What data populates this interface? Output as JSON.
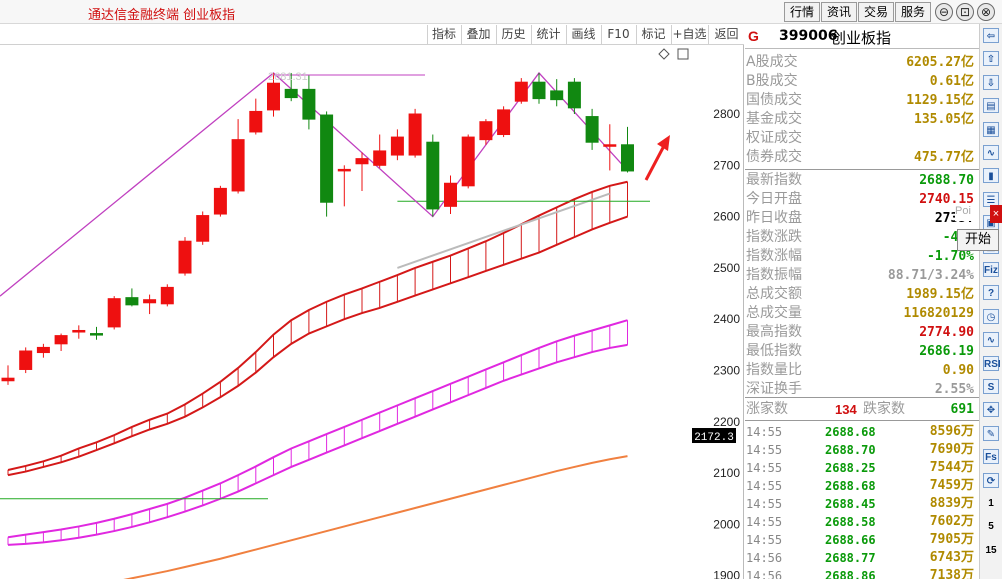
{
  "app_title": "通达信金融终端 创业板指",
  "menu": [
    "行情",
    "资讯",
    "交易",
    "服务"
  ],
  "window_controls": [
    "⊖",
    "⊡",
    "⊗"
  ],
  "toolbar": [
    "指标",
    "叠加",
    "历史",
    "统计",
    "画线",
    "F10",
    "标记",
    "+自选",
    "返回"
  ],
  "chart": {
    "overlay_label": "2681.31",
    "price_marker": "2172.3",
    "axis_labels": [
      "2800",
      "2700",
      "2600",
      "2500",
      "2400",
      "2300",
      "2200",
      "2100",
      "2000",
      "1900"
    ],
    "colors": {
      "up": "#ee1010",
      "down": "#118811",
      "zigzag": "#c040c0",
      "band_red": "#d41818",
      "band_magenta": "#e028e0",
      "orange": "#f08040"
    }
  },
  "chart_data": {
    "type": "candlestick",
    "title": "",
    "ylim": [
      1900,
      2850
    ],
    "candles": [
      {
        "o": 2280,
        "h": 2310,
        "l": 2272,
        "c": 2285
      },
      {
        "o": 2302,
        "h": 2345,
        "l": 2295,
        "c": 2338
      },
      {
        "o": 2335,
        "h": 2352,
        "l": 2325,
        "c": 2345
      },
      {
        "o": 2352,
        "h": 2372,
        "l": 2338,
        "c": 2368
      },
      {
        "o": 2375,
        "h": 2388,
        "l": 2362,
        "c": 2378
      },
      {
        "o": 2372,
        "h": 2385,
        "l": 2360,
        "c": 2370
      },
      {
        "o": 2385,
        "h": 2445,
        "l": 2380,
        "c": 2440
      },
      {
        "o": 2442,
        "h": 2460,
        "l": 2425,
        "c": 2428
      },
      {
        "o": 2432,
        "h": 2448,
        "l": 2410,
        "c": 2438
      },
      {
        "o": 2430,
        "h": 2468,
        "l": 2425,
        "c": 2462
      },
      {
        "o": 2490,
        "h": 2560,
        "l": 2485,
        "c": 2552
      },
      {
        "o": 2552,
        "h": 2610,
        "l": 2545,
        "c": 2602
      },
      {
        "o": 2605,
        "h": 2660,
        "l": 2600,
        "c": 2655
      },
      {
        "o": 2650,
        "h": 2790,
        "l": 2645,
        "c": 2750
      },
      {
        "o": 2765,
        "h": 2830,
        "l": 2760,
        "c": 2805
      },
      {
        "o": 2808,
        "h": 2880,
        "l": 2795,
        "c": 2860
      },
      {
        "o": 2848,
        "h": 2880,
        "l": 2825,
        "c": 2832
      },
      {
        "o": 2848,
        "h": 2875,
        "l": 2770,
        "c": 2790
      },
      {
        "o": 2798,
        "h": 2805,
        "l": 2600,
        "c": 2628
      },
      {
        "o": 2690,
        "h": 2700,
        "l": 2620,
        "c": 2692
      },
      {
        "o": 2703,
        "h": 2725,
        "l": 2650,
        "c": 2713
      },
      {
        "o": 2700,
        "h": 2760,
        "l": 2695,
        "c": 2728
      },
      {
        "o": 2720,
        "h": 2770,
        "l": 2710,
        "c": 2755
      },
      {
        "o": 2720,
        "h": 2810,
        "l": 2715,
        "c": 2800
      },
      {
        "o": 2745,
        "h": 2760,
        "l": 2600,
        "c": 2615
      },
      {
        "o": 2620,
        "h": 2680,
        "l": 2605,
        "c": 2665
      },
      {
        "o": 2660,
        "h": 2760,
        "l": 2655,
        "c": 2755
      },
      {
        "o": 2750,
        "h": 2790,
        "l": 2740,
        "c": 2785
      },
      {
        "o": 2760,
        "h": 2815,
        "l": 2755,
        "c": 2808
      },
      {
        "o": 2825,
        "h": 2870,
        "l": 2820,
        "c": 2862
      },
      {
        "o": 2862,
        "h": 2880,
        "l": 2820,
        "c": 2830
      },
      {
        "o": 2845,
        "h": 2868,
        "l": 2815,
        "c": 2828
      },
      {
        "o": 2862,
        "h": 2870,
        "l": 2800,
        "c": 2812
      },
      {
        "o": 2795,
        "h": 2810,
        "l": 2730,
        "c": 2745
      },
      {
        "o": 2740,
        "h": 2780,
        "l": 2690,
        "c": 2740
      },
      {
        "o": 2740,
        "h": 2775,
        "l": 2686,
        "c": 2689
      }
    ]
  },
  "panel": {
    "marker": "G",
    "code": "399006",
    "name": "创业板指",
    "stats": [
      {
        "label": "A股成交",
        "value": "6205.27亿",
        "color": "#b08a00"
      },
      {
        "label": "B股成交",
        "value": "0.61亿",
        "color": "#b08a00"
      },
      {
        "label": "国债成交",
        "value": "1129.15亿",
        "color": "#b08a00"
      },
      {
        "label": "基金成交",
        "value": "135.05亿",
        "color": "#b08a00"
      },
      {
        "label": "权证成交",
        "value": "",
        "color": "#b08a00"
      },
      {
        "label": "债券成交",
        "value": "475.77亿",
        "color": "#b08a00"
      }
    ],
    "quotes": [
      {
        "label": "最新指数",
        "value": "2688.70",
        "color": "#0a9a0a"
      },
      {
        "label": "今日开盘",
        "value": "2740.15",
        "color": "#d01010"
      },
      {
        "label": "昨日收盘",
        "value": "2735.",
        "color": "#000000"
      },
      {
        "label": "指数涨跌",
        "value": "-46.",
        "color": "#0a9a0a"
      },
      {
        "label": "指数涨幅",
        "value": "-1.70%",
        "color": "#0a9a0a"
      },
      {
        "label": "指数振幅",
        "value": "88.71/3.24%",
        "color": "#9a9a9a"
      },
      {
        "label": "总成交额",
        "value": "1989.15亿",
        "color": "#b08a00"
      },
      {
        "label": "总成交量",
        "value": "116820129",
        "color": "#b08a00"
      },
      {
        "label": "最高指数",
        "value": "2774.90",
        "color": "#d01010"
      },
      {
        "label": "最低指数",
        "value": "2686.19",
        "color": "#0a9a0a"
      },
      {
        "label": "指数量比",
        "value": "0.90",
        "color": "#b08a00"
      },
      {
        "label": "深证换手",
        "value": "2.55%",
        "color": "#9a9a9a"
      }
    ],
    "breadth": {
      "up_label": "涨家数",
      "up_count": "134",
      "down_label": "跌家数",
      "down_count": "691"
    },
    "ticks": [
      {
        "time": "14:55",
        "price": "2688.68",
        "vol": "8596万"
      },
      {
        "time": "14:55",
        "price": "2688.70",
        "vol": "7690万"
      },
      {
        "time": "14:55",
        "price": "2688.25",
        "vol": "7544万"
      },
      {
        "time": "14:55",
        "price": "2688.68",
        "vol": "7459万"
      },
      {
        "time": "14:55",
        "price": "2688.45",
        "vol": "8839万"
      },
      {
        "time": "14:55",
        "price": "2688.58",
        "vol": "7602万"
      },
      {
        "time": "14:55",
        "price": "2688.66",
        "vol": "7905万"
      },
      {
        "time": "14:56",
        "price": "2688.77",
        "vol": "6743万"
      },
      {
        "time": "14:56",
        "price": "2688.86",
        "vol": "7138万"
      }
    ]
  },
  "popups": {
    "a": "Poi",
    "b": "开始"
  },
  "strip_icons": [
    "arrow-left-icon",
    "arrow-up-icon",
    "arrow-down-icon",
    "chart-icon",
    "book-icon",
    "line-chart-icon",
    "candle-icon",
    "list-icon",
    "grid-icon",
    "calendar-icon",
    "fiz-icon",
    "question-icon",
    "clock-icon",
    "rsi-icon",
    "s-icon",
    "move-icon",
    "pen-icon",
    "fs-icon",
    "refresh-icon"
  ],
  "strip_labels": [
    "⇦",
    "⇧",
    "⇩",
    "▤",
    "▦",
    "∿",
    "▮",
    "☰",
    "▣",
    "",
    "",
    "",
    "",
    "",
    "",
    "",
    "",
    "",
    "",
    "",
    "",
    "",
    "",
    "",
    "",
    "",
    "",
    "",
    "",
    "",
    ""
  ],
  "strip_text": {
    "fiz": "Fiz",
    "rsi": "RSI",
    "fs": "Fs",
    "n1": "1",
    "n5": "5",
    "n15": "15"
  }
}
